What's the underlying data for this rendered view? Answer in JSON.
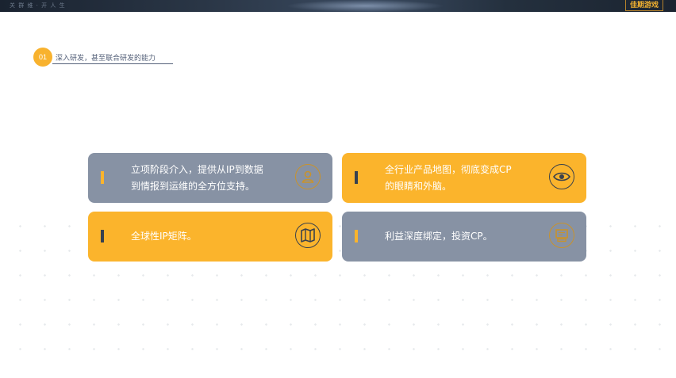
{
  "topbar": {
    "faint_text_left": "关  群  维      ·      开  人  生",
    "brand": "佳期游戏"
  },
  "section": {
    "number": "01",
    "title": "深入研发，甚至联合研发的能力"
  },
  "cards": [
    {
      "line1": "立项阶段介入，提供从IP到数据",
      "line2": "到情报到运维的全方位支持。",
      "icon": "person-icon"
    },
    {
      "line1": "全行业产品地图，彻底变成CP",
      "line2": "的眼睛和外脑。",
      "icon": "eye-icon"
    },
    {
      "line1": "全球性IP矩阵。",
      "icon": "map-icon"
    },
    {
      "line1": "利益深度绑定，投资CP。",
      "icon": "computer-icon"
    }
  ],
  "colors": {
    "gray": "#8792a4",
    "yellow": "#fbb42c",
    "dark": "#37414f"
  }
}
